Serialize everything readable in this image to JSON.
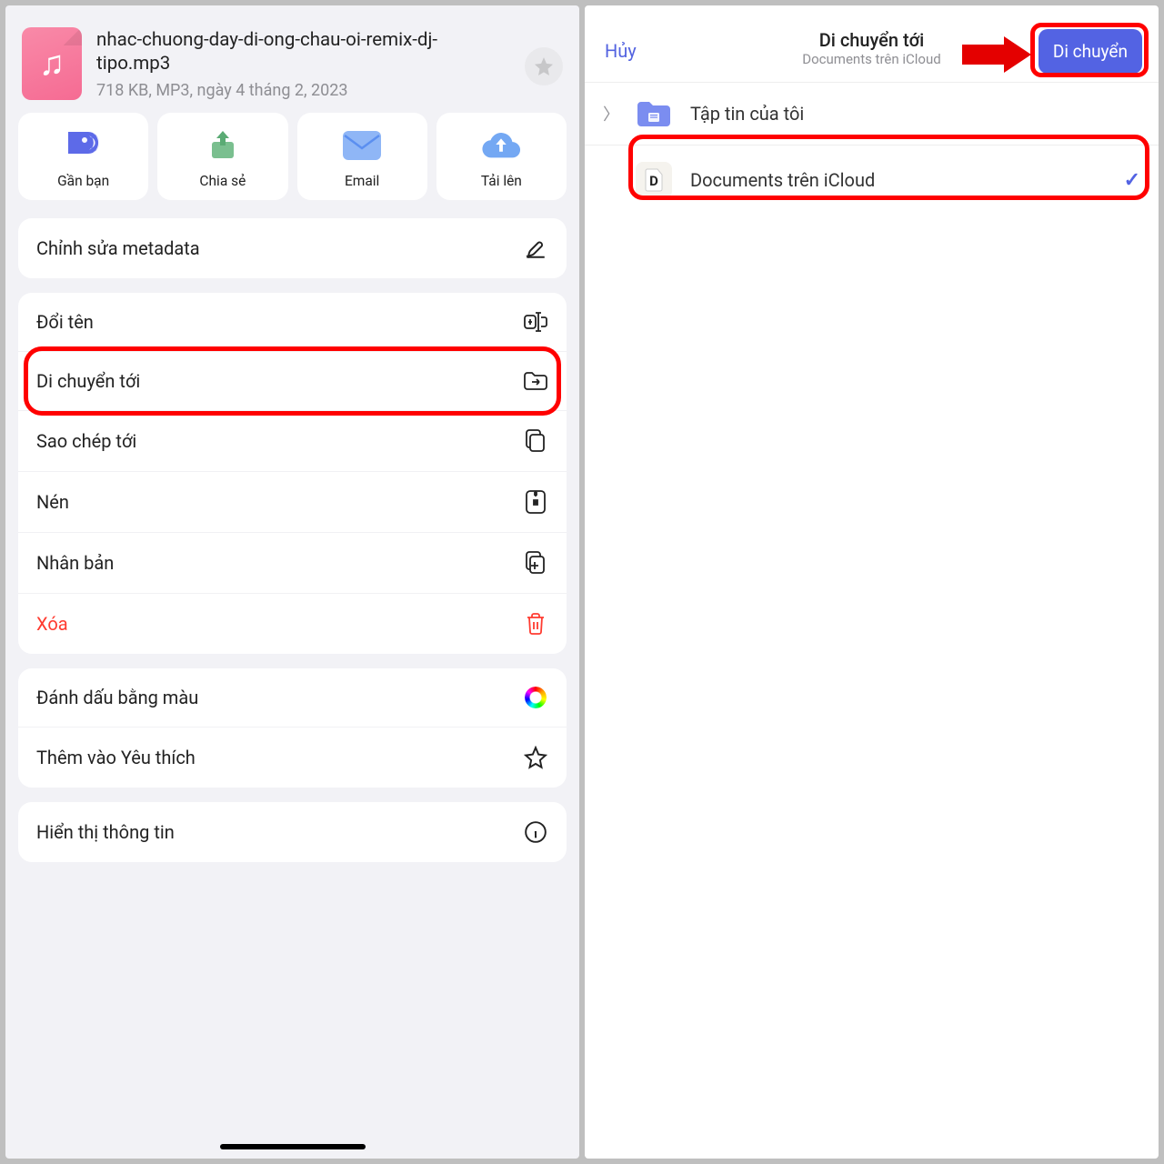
{
  "left": {
    "file": {
      "name": "nhac-chuong-day-di-ong-chau-oi-remix-dj-tipo.mp3",
      "meta": "718 KB, MP3, ngày 4 tháng 2, 2023"
    },
    "actions": [
      {
        "label": "Gần bạn"
      },
      {
        "label": "Chia sẻ"
      },
      {
        "label": "Email"
      },
      {
        "label": "Tải lên"
      }
    ],
    "menu": {
      "edit_metadata": "Chỉnh sửa metadata",
      "rename": "Đổi tên",
      "move_to": "Di chuyển tới",
      "copy_to": "Sao chép tới",
      "compress": "Nén",
      "duplicate": "Nhân bản",
      "delete": "Xóa",
      "color_tag": "Đánh dấu bằng màu",
      "favorite": "Thêm vào Yêu thích",
      "show_info": "Hiển thị thông tin"
    }
  },
  "right": {
    "cancel": "Hủy",
    "title": "Di chuyển tới",
    "subtitle": "Documents trên iCloud",
    "move": "Di chuyển",
    "folders": {
      "my_files": "Tập tin của tôi",
      "icloud": "Documents trên iCloud"
    }
  }
}
